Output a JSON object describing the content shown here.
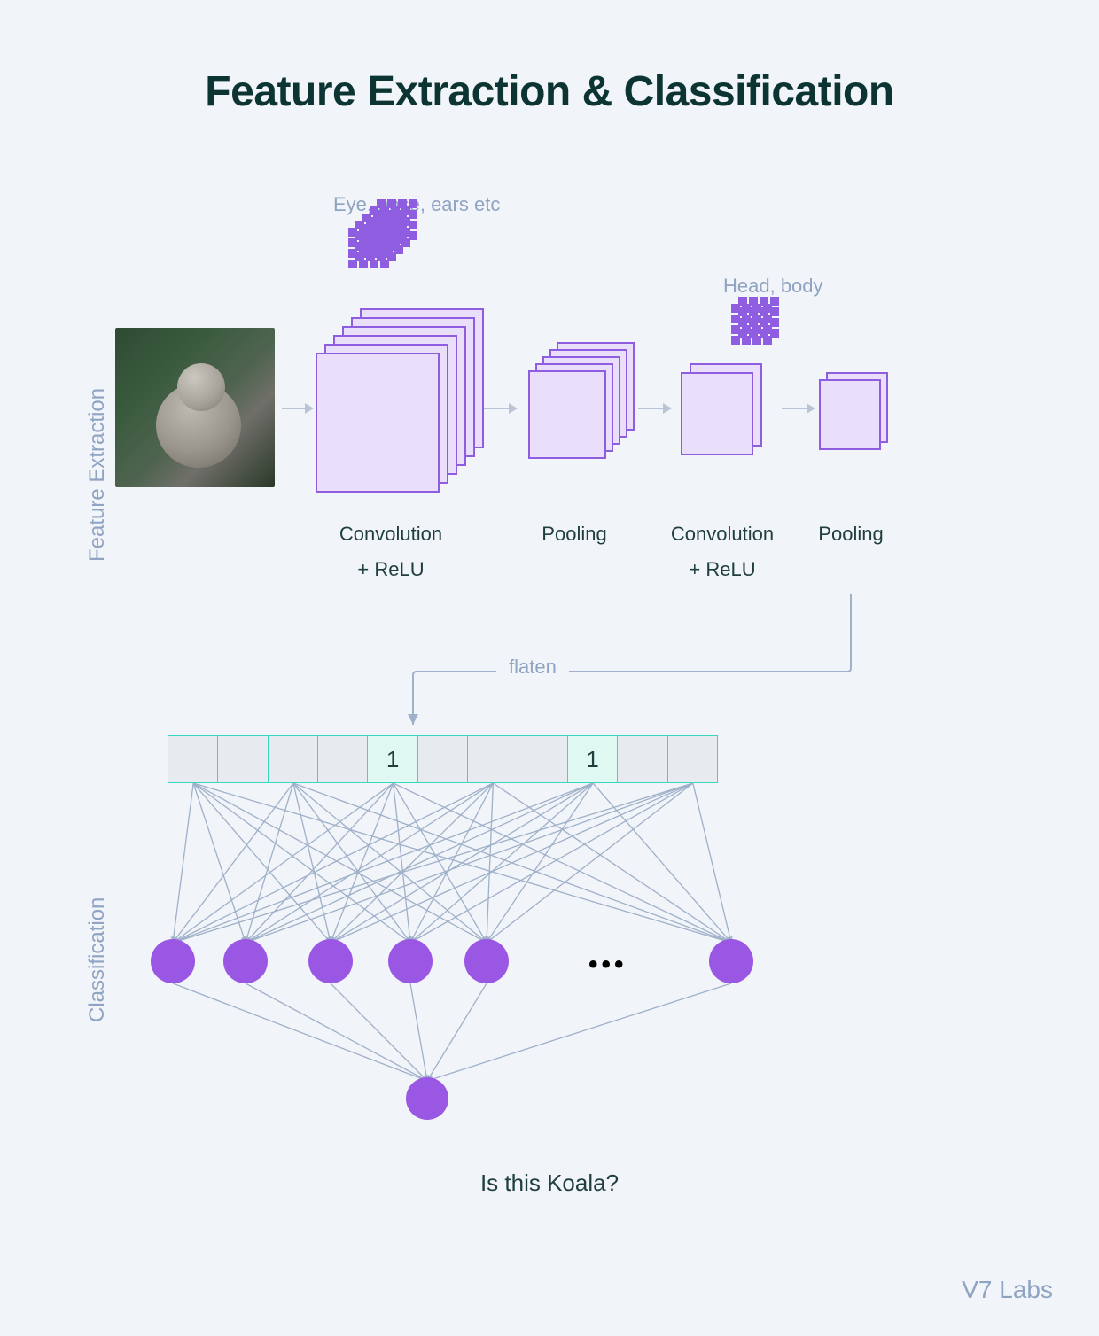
{
  "title": "Feature Extraction & Classification",
  "sections": {
    "feature_extraction": "Feature Extraction",
    "classification": "Classification"
  },
  "annotations": {
    "conv1_features": "Eye, nose, ears etc",
    "conv2_features": "Head, body"
  },
  "stages": {
    "conv1": "Convolution",
    "conv1b": "+ ReLU",
    "pool1": "Pooling",
    "conv2": "Convolution",
    "conv2b": "+ ReLU",
    "pool2": "Pooling"
  },
  "flatten_label": "flaten",
  "vector": {
    "cells": 11,
    "values": {
      "4": "1",
      "8": "1"
    }
  },
  "output_question": "Is this Koala?",
  "credit": "V7 Labs",
  "colors": {
    "accent_purple": "#8e5de0",
    "node_purple": "#9a57e4",
    "teal": "#35d9c0",
    "label_blue": "#8fa3c2",
    "dark_teal": "#1f3f3d"
  }
}
